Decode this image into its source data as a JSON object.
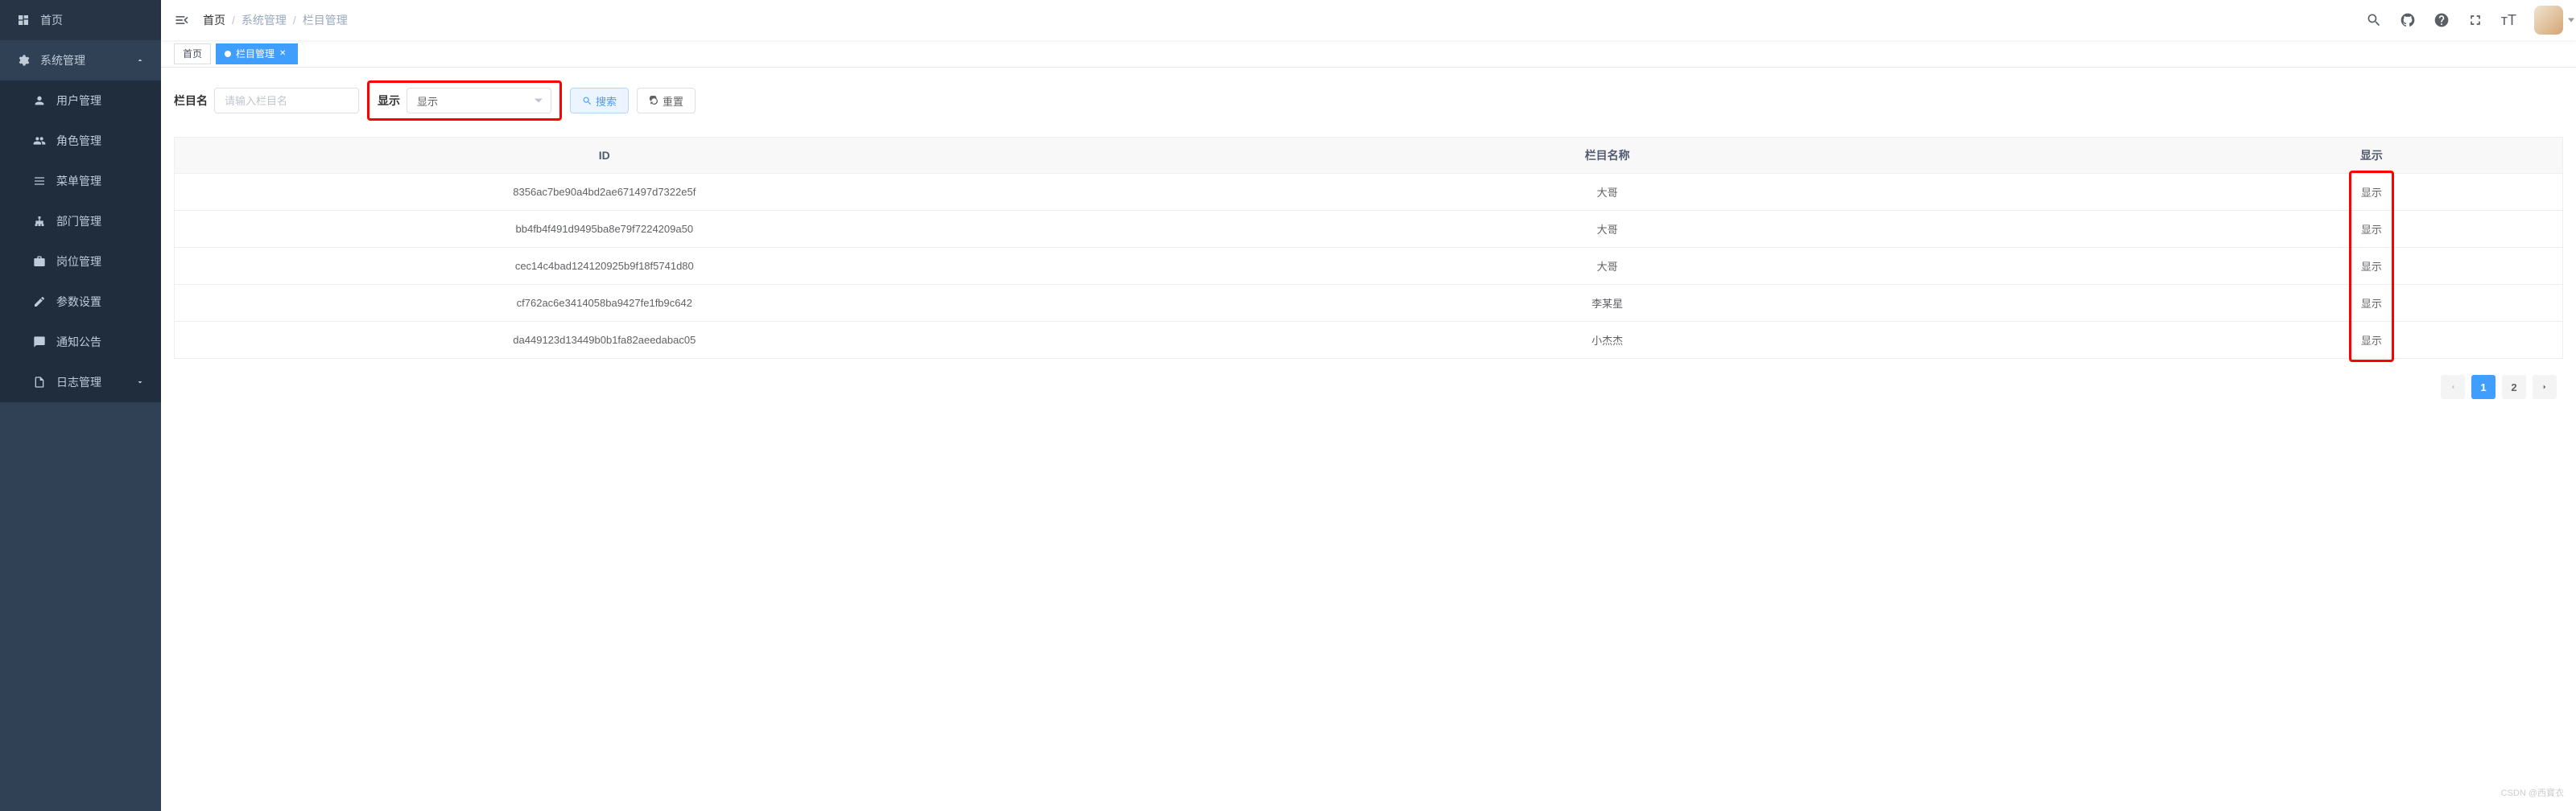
{
  "sidebar": {
    "home": "首页",
    "system_management": "系统管理",
    "items": [
      {
        "label": "用户管理"
      },
      {
        "label": "角色管理"
      },
      {
        "label": "菜单管理"
      },
      {
        "label": "部门管理"
      },
      {
        "label": "岗位管理"
      },
      {
        "label": "参数设置"
      },
      {
        "label": "通知公告"
      },
      {
        "label": "日志管理"
      }
    ]
  },
  "breadcrumb": {
    "home": "首页",
    "sep": "/",
    "items": [
      "系统管理",
      "栏目管理"
    ]
  },
  "tabs": [
    {
      "label": "首页",
      "active": false,
      "closable": false
    },
    {
      "label": "栏目管理",
      "active": true,
      "closable": true
    }
  ],
  "search": {
    "name_label": "栏目名",
    "name_placeholder": "请输入栏目名",
    "show_label": "显示",
    "show_value": "显示",
    "search_btn": "搜索",
    "reset_btn": "重置"
  },
  "table": {
    "headers": {
      "id": "ID",
      "name": "栏目名称",
      "show": "显示"
    },
    "rows": [
      {
        "id": "8356ac7be90a4bd2ae671497d7322e5f",
        "name": "大哥",
        "show": "显示"
      },
      {
        "id": "bb4fb4f491d9495ba8e79f7224209a50",
        "name": "大哥",
        "show": "显示"
      },
      {
        "id": "cec14c4bad124120925b9f18f5741d80",
        "name": "大哥",
        "show": "显示"
      },
      {
        "id": "cf762ac6e3414058ba9427fe1fb9c642",
        "name": "李某星",
        "show": "显示"
      },
      {
        "id": "da449123d13449b0b1fa82aeedabac05",
        "name": "小杰杰",
        "show": "显示"
      }
    ]
  },
  "pagination": {
    "current": "1",
    "pages": [
      "1",
      "2"
    ]
  },
  "watermark": "CSDN @西寳衣"
}
